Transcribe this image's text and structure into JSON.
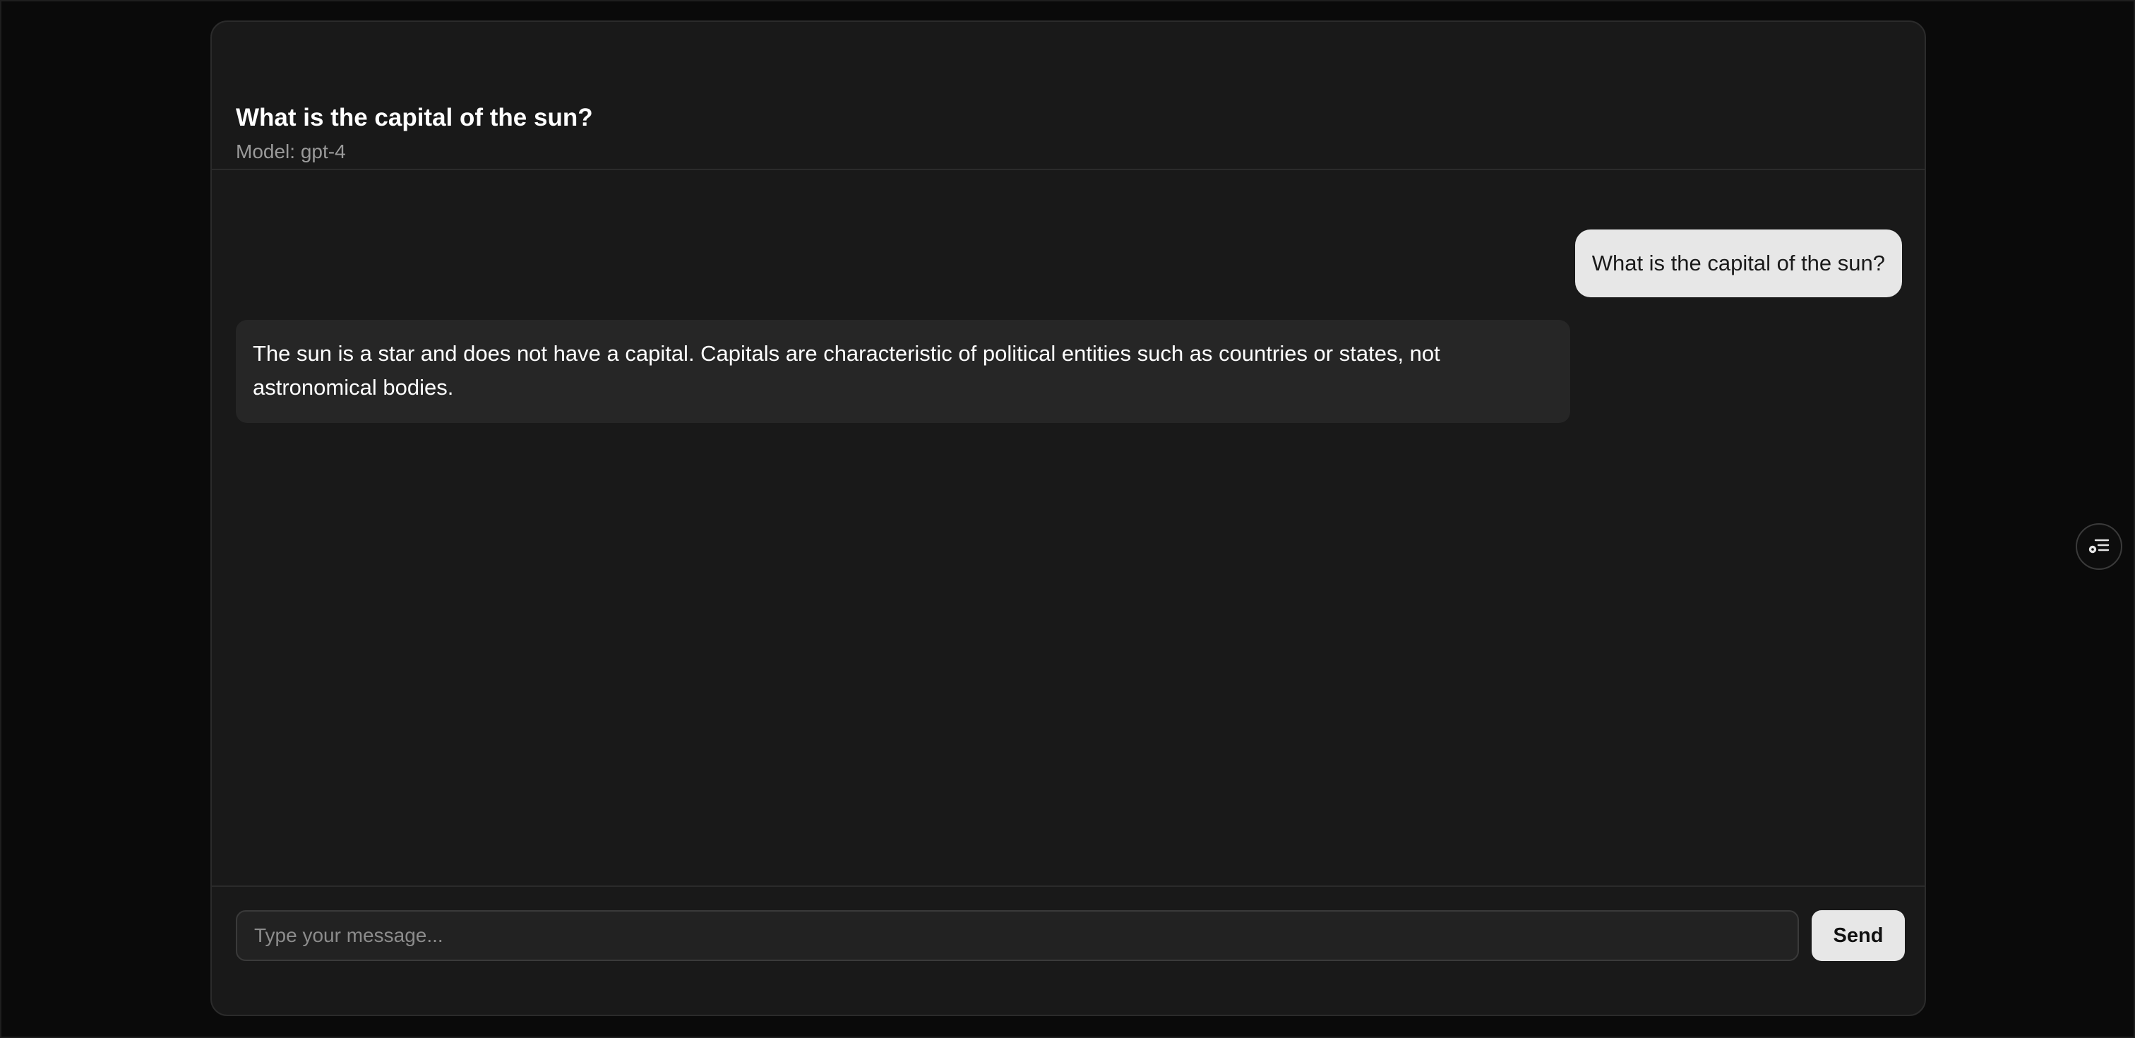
{
  "chat": {
    "title": "What is the capital of the sun?",
    "model_label": "Model: gpt-4"
  },
  "messages": [
    {
      "role": "user",
      "text": "What is the capital of the sun?"
    },
    {
      "role": "assistant",
      "text": "The sun is a star and does not have a capital. Capitals are characteristic of political entities such as countries or states, not astronomical bodies."
    }
  ],
  "composer": {
    "placeholder": "Type your message...",
    "value": "",
    "send_label": "Send"
  },
  "side_toggle": {
    "icon": "list-settings-icon"
  },
  "colors": {
    "background": "#0a0a0a",
    "panel": "#191919",
    "user_bubble": "#e7e7e7",
    "assistant_bubble": "#262626",
    "button": "#e7e7e7"
  }
}
